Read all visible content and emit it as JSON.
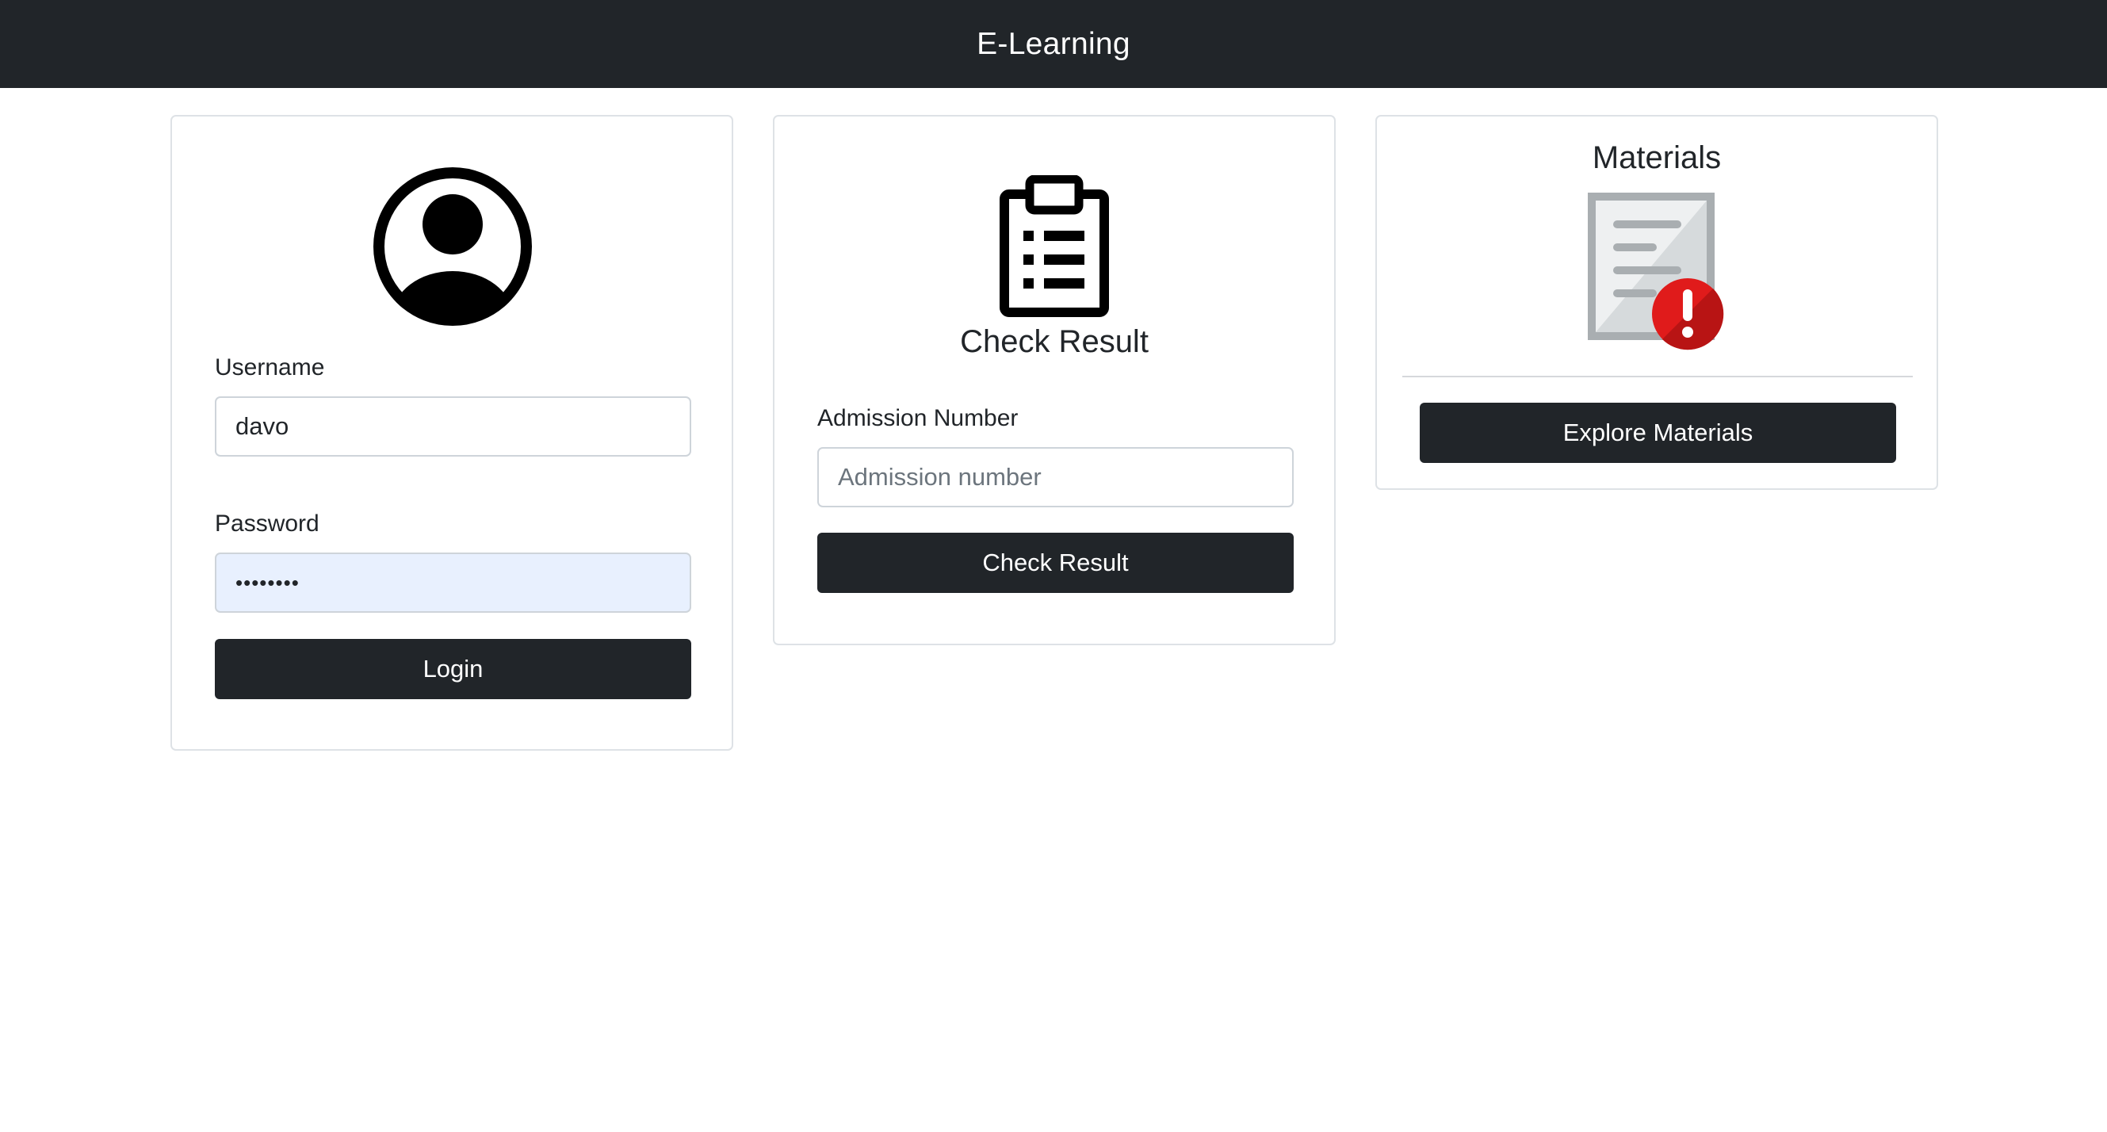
{
  "navbar": {
    "brand": "E-Learning"
  },
  "login_card": {
    "username_label": "Username",
    "username_value": "davo",
    "password_label": "Password",
    "password_value": "••••••••",
    "login_button": "Login"
  },
  "result_card": {
    "title": "Check Result",
    "admission_label": "Admission Number",
    "admission_placeholder": "Admission number",
    "check_button": "Check Result"
  },
  "materials_card": {
    "title": "Materials",
    "explore_button": "Explore Materials"
  },
  "icons": {
    "login": "user-circle-icon",
    "result": "clipboard-list-icon",
    "materials": "document-alert-icon"
  },
  "colors": {
    "navbar": "#212529",
    "button": "#212529",
    "autofill": "#e8f0fe",
    "alert": "#e01b1b"
  }
}
